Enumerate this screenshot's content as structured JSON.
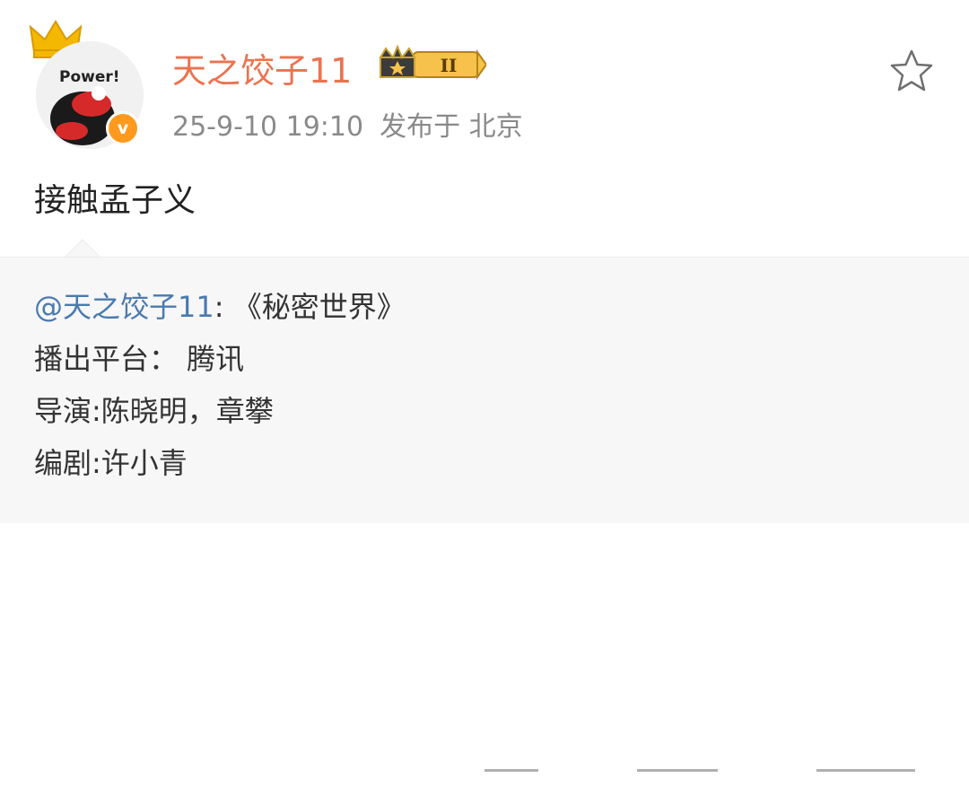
{
  "user": {
    "name": "天之饺子11",
    "avatar_caption": "Power!",
    "verified_badge": "v",
    "level_badge": "II"
  },
  "meta": {
    "time": "25-9-10 19:10",
    "location": "发布于 北京"
  },
  "post": {
    "text": "接触孟子义"
  },
  "repost": {
    "mention": "@天之饺子11",
    "title": ": 《秘密世界》",
    "line2": "播出平台： 腾讯",
    "line3": "导演:陈晓明，章攀",
    "line4": "编剧:许小青"
  },
  "colors": {
    "username": "#eb7350",
    "mention": "#4a7ab0",
    "repost_bg": "#f7f7f7"
  },
  "icons": {
    "favorite": "star-outline-icon",
    "crown": "crown-icon"
  }
}
